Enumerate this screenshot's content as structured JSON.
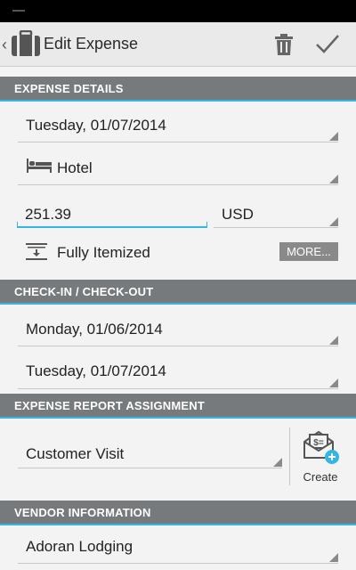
{
  "header": {
    "title": "Edit Expense"
  },
  "icons": {
    "back": "chevron-left-icon",
    "app": "briefcase-icon",
    "delete": "trash-icon",
    "save": "checkmark-icon",
    "category": "bed-icon",
    "itemization": "itemize-icon",
    "create": "money-envelope-add-icon"
  },
  "colors": {
    "accent": "#33b5e5",
    "section_header": "#777a7c"
  },
  "expense_details": {
    "header": "EXPENSE DETAILS",
    "date": "Tuesday, 01/07/2014",
    "type": "Hotel",
    "amount": "251.39",
    "currency": "USD",
    "itemization": "Fully Itemized",
    "more_label": "MORE..."
  },
  "checkin": {
    "header": "CHECK-IN / CHECK-OUT",
    "checkin_date": "Monday, 01/06/2014",
    "checkout_date": "Tuesday, 01/07/2014"
  },
  "report": {
    "header": "EXPENSE REPORT ASSIGNMENT",
    "value": "Customer Visit",
    "create_label": "Create"
  },
  "vendor": {
    "header": "VENDOR INFORMATION",
    "name": "Adoran Lodging"
  }
}
